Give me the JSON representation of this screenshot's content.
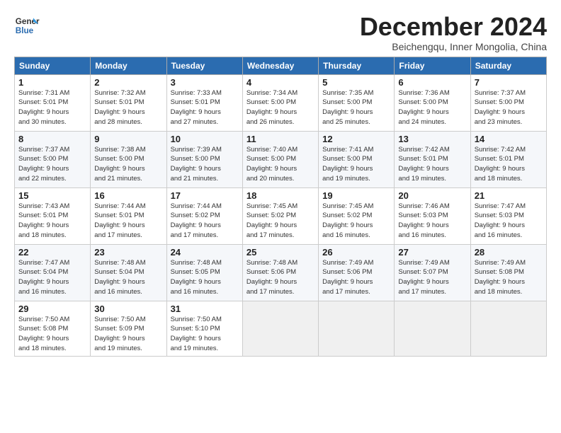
{
  "header": {
    "logo_line1": "General",
    "logo_line2": "Blue",
    "month": "December 2024",
    "location": "Beichengqu, Inner Mongolia, China"
  },
  "weekdays": [
    "Sunday",
    "Monday",
    "Tuesday",
    "Wednesday",
    "Thursday",
    "Friday",
    "Saturday"
  ],
  "weeks": [
    [
      {
        "day": "1",
        "info": "Sunrise: 7:31 AM\nSunset: 5:01 PM\nDaylight: 9 hours\nand 30 minutes."
      },
      {
        "day": "2",
        "info": "Sunrise: 7:32 AM\nSunset: 5:01 PM\nDaylight: 9 hours\nand 28 minutes."
      },
      {
        "day": "3",
        "info": "Sunrise: 7:33 AM\nSunset: 5:01 PM\nDaylight: 9 hours\nand 27 minutes."
      },
      {
        "day": "4",
        "info": "Sunrise: 7:34 AM\nSunset: 5:00 PM\nDaylight: 9 hours\nand 26 minutes."
      },
      {
        "day": "5",
        "info": "Sunrise: 7:35 AM\nSunset: 5:00 PM\nDaylight: 9 hours\nand 25 minutes."
      },
      {
        "day": "6",
        "info": "Sunrise: 7:36 AM\nSunset: 5:00 PM\nDaylight: 9 hours\nand 24 minutes."
      },
      {
        "day": "7",
        "info": "Sunrise: 7:37 AM\nSunset: 5:00 PM\nDaylight: 9 hours\nand 23 minutes."
      }
    ],
    [
      {
        "day": "8",
        "info": "Sunrise: 7:37 AM\nSunset: 5:00 PM\nDaylight: 9 hours\nand 22 minutes."
      },
      {
        "day": "9",
        "info": "Sunrise: 7:38 AM\nSunset: 5:00 PM\nDaylight: 9 hours\nand 21 minutes."
      },
      {
        "day": "10",
        "info": "Sunrise: 7:39 AM\nSunset: 5:00 PM\nDaylight: 9 hours\nand 21 minutes."
      },
      {
        "day": "11",
        "info": "Sunrise: 7:40 AM\nSunset: 5:00 PM\nDaylight: 9 hours\nand 20 minutes."
      },
      {
        "day": "12",
        "info": "Sunrise: 7:41 AM\nSunset: 5:00 PM\nDaylight: 9 hours\nand 19 minutes."
      },
      {
        "day": "13",
        "info": "Sunrise: 7:42 AM\nSunset: 5:01 PM\nDaylight: 9 hours\nand 19 minutes."
      },
      {
        "day": "14",
        "info": "Sunrise: 7:42 AM\nSunset: 5:01 PM\nDaylight: 9 hours\nand 18 minutes."
      }
    ],
    [
      {
        "day": "15",
        "info": "Sunrise: 7:43 AM\nSunset: 5:01 PM\nDaylight: 9 hours\nand 18 minutes."
      },
      {
        "day": "16",
        "info": "Sunrise: 7:44 AM\nSunset: 5:01 PM\nDaylight: 9 hours\nand 17 minutes."
      },
      {
        "day": "17",
        "info": "Sunrise: 7:44 AM\nSunset: 5:02 PM\nDaylight: 9 hours\nand 17 minutes."
      },
      {
        "day": "18",
        "info": "Sunrise: 7:45 AM\nSunset: 5:02 PM\nDaylight: 9 hours\nand 17 minutes."
      },
      {
        "day": "19",
        "info": "Sunrise: 7:45 AM\nSunset: 5:02 PM\nDaylight: 9 hours\nand 16 minutes."
      },
      {
        "day": "20",
        "info": "Sunrise: 7:46 AM\nSunset: 5:03 PM\nDaylight: 9 hours\nand 16 minutes."
      },
      {
        "day": "21",
        "info": "Sunrise: 7:47 AM\nSunset: 5:03 PM\nDaylight: 9 hours\nand 16 minutes."
      }
    ],
    [
      {
        "day": "22",
        "info": "Sunrise: 7:47 AM\nSunset: 5:04 PM\nDaylight: 9 hours\nand 16 minutes."
      },
      {
        "day": "23",
        "info": "Sunrise: 7:48 AM\nSunset: 5:04 PM\nDaylight: 9 hours\nand 16 minutes."
      },
      {
        "day": "24",
        "info": "Sunrise: 7:48 AM\nSunset: 5:05 PM\nDaylight: 9 hours\nand 16 minutes."
      },
      {
        "day": "25",
        "info": "Sunrise: 7:48 AM\nSunset: 5:06 PM\nDaylight: 9 hours\nand 17 minutes."
      },
      {
        "day": "26",
        "info": "Sunrise: 7:49 AM\nSunset: 5:06 PM\nDaylight: 9 hours\nand 17 minutes."
      },
      {
        "day": "27",
        "info": "Sunrise: 7:49 AM\nSunset: 5:07 PM\nDaylight: 9 hours\nand 17 minutes."
      },
      {
        "day": "28",
        "info": "Sunrise: 7:49 AM\nSunset: 5:08 PM\nDaylight: 9 hours\nand 18 minutes."
      }
    ],
    [
      {
        "day": "29",
        "info": "Sunrise: 7:50 AM\nSunset: 5:08 PM\nDaylight: 9 hours\nand 18 minutes."
      },
      {
        "day": "30",
        "info": "Sunrise: 7:50 AM\nSunset: 5:09 PM\nDaylight: 9 hours\nand 19 minutes."
      },
      {
        "day": "31",
        "info": "Sunrise: 7:50 AM\nSunset: 5:10 PM\nDaylight: 9 hours\nand 19 minutes."
      },
      {
        "day": "",
        "info": ""
      },
      {
        "day": "",
        "info": ""
      },
      {
        "day": "",
        "info": ""
      },
      {
        "day": "",
        "info": ""
      }
    ]
  ]
}
